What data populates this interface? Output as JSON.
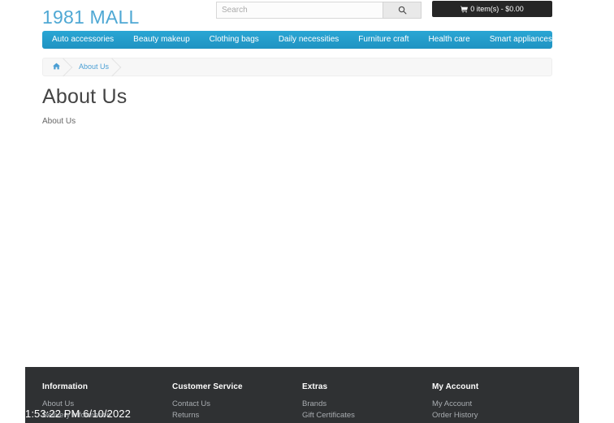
{
  "header": {
    "logo": "1981 MALL",
    "search": {
      "placeholder": "Search",
      "value": "",
      "button_icon": "search-icon"
    },
    "cart": {
      "label": "0 item(s) - $0.00",
      "icon": "shopping-cart-icon"
    }
  },
  "nav": {
    "items": [
      {
        "label": "Auto accessories"
      },
      {
        "label": "Beauty makeup"
      },
      {
        "label": "Clothing bags"
      },
      {
        "label": "Daily necessities"
      },
      {
        "label": "Furniture craft"
      },
      {
        "label": "Health care"
      },
      {
        "label": "Smart appliances"
      }
    ]
  },
  "breadcrumb": {
    "home_icon": "home-icon",
    "items": [
      {
        "label": "About Us"
      }
    ]
  },
  "main": {
    "title": "About Us",
    "body": "About Us"
  },
  "footer": {
    "columns": [
      {
        "title": "Information",
        "links": [
          {
            "label": "About Us"
          },
          {
            "label": "Delivery Information"
          }
        ]
      },
      {
        "title": "Customer Service",
        "links": [
          {
            "label": "Contact Us"
          },
          {
            "label": "Returns"
          }
        ]
      },
      {
        "title": "Extras",
        "links": [
          {
            "label": "Brands"
          },
          {
            "label": "Gift Certificates"
          }
        ]
      },
      {
        "title": "My Account",
        "links": [
          {
            "label": "My Account"
          },
          {
            "label": "Order History"
          }
        ]
      }
    ]
  },
  "overlay": {
    "timestamp": "1:53:22 PM 6/10/2022"
  },
  "colors": {
    "accent_blue": "#229ac8",
    "logo_blue": "#4fa8d4",
    "cart_dark": "#262626",
    "footer_dark": "#2f3133",
    "link_gray": "#a8acb0"
  }
}
